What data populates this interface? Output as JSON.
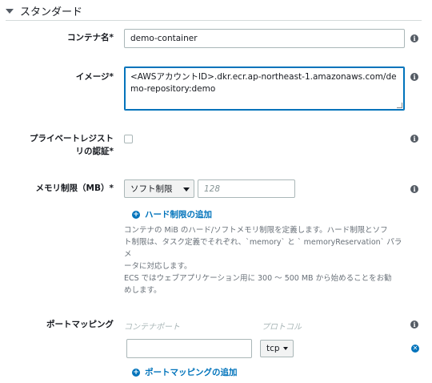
{
  "section": {
    "title": "スタンダード"
  },
  "fields": {
    "container_name": {
      "label": "コンテナ名*",
      "value": "demo-container"
    },
    "image": {
      "label": "イメージ*",
      "value": "<AWSアカウントID>.dkr.ecr.ap-northeast-1.amazonaws.com/demo-repository:demo"
    },
    "private_registry": {
      "label_line1": "プライベートレジスト",
      "label_line2": "リの認証*"
    },
    "memory": {
      "label": "メモリ制限（MB）*",
      "select_value": "ソフト制限",
      "placeholder": "128",
      "add_hard_limit": "ハード制限の追加",
      "help_lines": [
        "コンテナの MiB のハード/ソフトメモリ制限を定義します。ハード制限とソフ",
        "ト制限は、タスク定義でそれぞれ、`memory` と ` memoryReservation` パラメ",
        "ータに対応します。",
        "ECS ではウェブアプリケーション用に 300 〜 500 MB から始めることをお勧",
        "めします。"
      ]
    },
    "port_mapping": {
      "label": "ポートマッピング",
      "col_container_port": "コンテナポート",
      "col_protocol": "プロトコル",
      "protocol_value": "tcp",
      "add_label": "ポートマッピングの追加"
    }
  },
  "icons": {
    "info": "info-icon",
    "plus": "plus-circle-icon",
    "remove": "remove-circle-icon",
    "caret": "caret-down-icon"
  },
  "colors": {
    "link": "#0073bb",
    "focus": "#0073bb",
    "border": "#aab7b8"
  }
}
